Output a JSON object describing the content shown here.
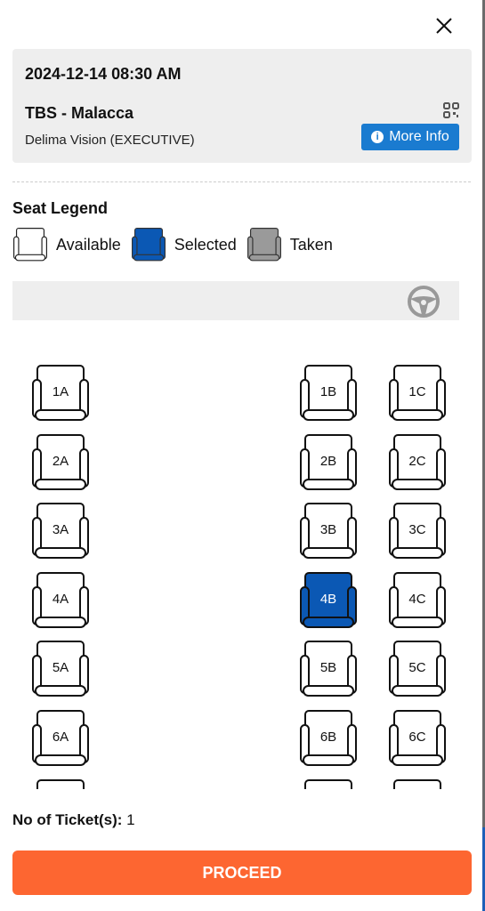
{
  "trip": {
    "datetime": "2024-12-14 08:30 AM",
    "route": "TBS - Malacca",
    "bus": "Delima Vision (EXECUTIVE)",
    "more_info": "More Info"
  },
  "legend": {
    "title": "Seat Legend",
    "items": [
      {
        "label": "Available",
        "color": "#ffffff"
      },
      {
        "label": "Selected",
        "color": "#0b58b4"
      },
      {
        "label": "Taken",
        "color": "#9a9a9a"
      }
    ]
  },
  "seats": [
    {
      "label": "1A",
      "status": "available"
    },
    {
      "label": "1B",
      "status": "available"
    },
    {
      "label": "1C",
      "status": "available"
    },
    {
      "label": "2A",
      "status": "available"
    },
    {
      "label": "2B",
      "status": "available"
    },
    {
      "label": "2C",
      "status": "available"
    },
    {
      "label": "3A",
      "status": "available"
    },
    {
      "label": "3B",
      "status": "available"
    },
    {
      "label": "3C",
      "status": "available"
    },
    {
      "label": "4A",
      "status": "available"
    },
    {
      "label": "4B",
      "status": "selected"
    },
    {
      "label": "4C",
      "status": "available"
    },
    {
      "label": "5A",
      "status": "available"
    },
    {
      "label": "5B",
      "status": "available"
    },
    {
      "label": "5C",
      "status": "available"
    },
    {
      "label": "6A",
      "status": "available"
    },
    {
      "label": "6B",
      "status": "available"
    },
    {
      "label": "6C",
      "status": "available"
    }
  ],
  "footer": {
    "tickets_label": "No of Ticket(s):",
    "tickets_count": "1",
    "proceed": "PROCEED"
  },
  "colors": {
    "accent": "#fd6631",
    "selected": "#0b58b4",
    "info_button": "#1a7bd0"
  }
}
